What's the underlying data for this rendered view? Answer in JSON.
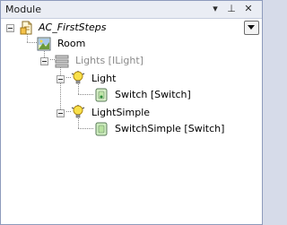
{
  "panel": {
    "title": "Module",
    "buttons": {
      "dropdown": "▾",
      "pin": "⊥",
      "close": "✕"
    }
  },
  "tree": {
    "root": {
      "label": "AC_FirstSteps",
      "icon": "document-icon"
    },
    "room": {
      "label": "Room",
      "icon": "room-picture-icon"
    },
    "lights": {
      "label": "Lights [ILight]",
      "icon": "list-icon"
    },
    "light": {
      "label": "Light",
      "icon": "lightbulb-icon"
    },
    "switch": {
      "label": "Switch [Switch]",
      "icon": "switch-icon"
    },
    "light_simple": {
      "label": "LightSimple",
      "icon": "lightbulb-icon"
    },
    "switch_simple": {
      "label": "SwitchSimple [Switch]",
      "icon": "switch-icon"
    }
  },
  "colors": {
    "panel_border": "#8e9bbc",
    "titlebar": "#eaedf4",
    "disabled_text": "#8a8a8a"
  }
}
